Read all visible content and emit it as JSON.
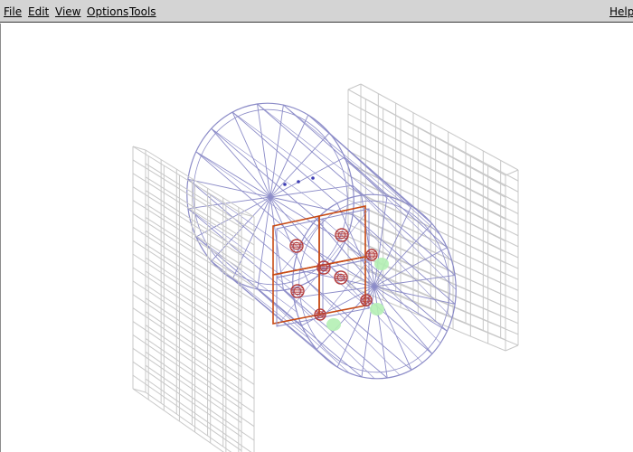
{
  "menubar": {
    "items": [
      "File",
      "Edit",
      "View",
      "Options",
      "Tools"
    ],
    "help": "Help"
  },
  "scene": {
    "background": "#ffffff",
    "panel_color": "#c8c8c8",
    "wire_color": "#8c8cc8",
    "frame_color": "#c84a14",
    "node_color": "#b43c3c",
    "marker_color": "#b4f0b4",
    "dot_color": "#3c3cb4"
  }
}
